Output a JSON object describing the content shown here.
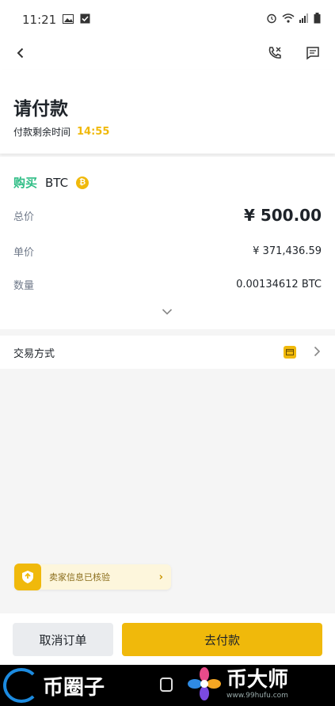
{
  "status_bar": {
    "time": "11:21"
  },
  "header": {
    "title": "请付款",
    "countdown_label": "付款剩余时间",
    "countdown_value": "14:55"
  },
  "order": {
    "side": "购买",
    "asset": "BTC",
    "asset_badge": "₿",
    "rows": [
      {
        "label": "总价",
        "value": "¥ 500.00"
      },
      {
        "label": "单价",
        "value": "¥ 371,436.59"
      },
      {
        "label": "数量",
        "value": "0.00134612 BTC"
      }
    ]
  },
  "payment_method": {
    "label": "交易方式"
  },
  "seller_notice": {
    "text": "卖家信息已核验"
  },
  "actions": {
    "cancel_label": "取消订单",
    "pay_label": "去付款"
  },
  "watermark": {
    "left_brand": "币圈子",
    "right_brand": "币大师",
    "right_url": "www.99hufu.com"
  },
  "colors": {
    "accent": "#f0b90b",
    "buy": "#2ebd85",
    "text": "#1e2329",
    "muted": "#707a8a"
  },
  "icons": [
    "back-arrow-icon",
    "phone-icon",
    "chat-icon",
    "bitcoin-icon",
    "chevron-down-icon",
    "payment-card-icon",
    "chevron-right-icon",
    "verified-shield-icon"
  ]
}
